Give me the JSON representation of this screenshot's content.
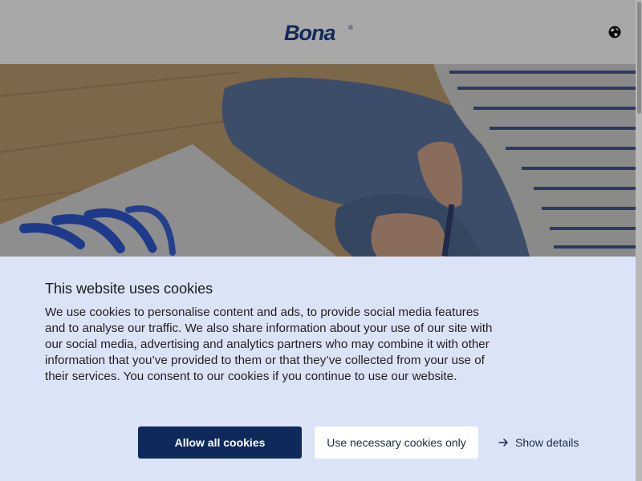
{
  "header": {
    "logo_text": "Bona",
    "logo_registered": "®",
    "language_icon": "globe-icon"
  },
  "hero": {
    "image_description_icon": "hero-photo"
  },
  "cookie_banner": {
    "title": "This website uses cookies",
    "body": "We use cookies to personalise content and ads, to provide social media features and to analyse our traffic. We also share information about your use of our site with our social media, advertising and analytics partners who may combine it with other information that you’ve provided to them or that they’ve collected from your use of their services. You consent to our cookies if you continue to use our website.",
    "allow_all_label": "Allow all cookies",
    "necessary_label": "Use necessary cookies only",
    "show_details_label": "Show details",
    "show_details_icon": "arrow-right-icon"
  },
  "colors": {
    "brand": "#0f2a5a",
    "banner_bg": "#dbe4f7",
    "button_secondary_bg": "#ffffff"
  }
}
